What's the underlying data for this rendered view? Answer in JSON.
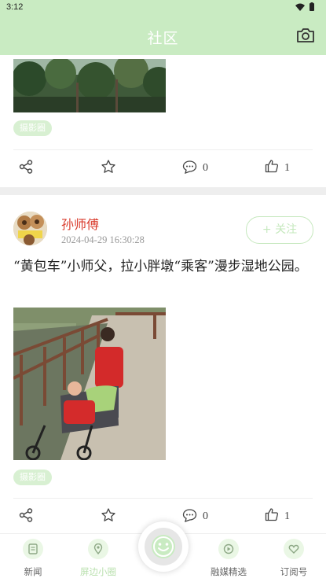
{
  "status": {
    "time": "3:12"
  },
  "appbar": {
    "title": "社区",
    "camera_icon": "camera-icon"
  },
  "post1": {
    "tag": "摄影圈",
    "comments": "0",
    "likes": "1"
  },
  "post2": {
    "author": "孙师傅",
    "time": "2024-04-29 16:30:28",
    "follow_label": "+ 关注",
    "text": "“黄包车”小师父，拉小胖墩“乘客”漫步湿地公园。",
    "tag": "摄影圈",
    "comments": "0",
    "likes": "1"
  },
  "nav": [
    {
      "label": "新闻",
      "icon": "news-icon"
    },
    {
      "label": "屏边小圈",
      "icon": "location-icon"
    },
    {
      "label": "融媒精选",
      "icon": "play-icon"
    },
    {
      "label": "订阅号",
      "icon": "heart-icon"
    }
  ],
  "colors": {
    "accent": "#c9ebc2",
    "author": "#d93a2b",
    "tag_bg": "#d8f0d2"
  }
}
